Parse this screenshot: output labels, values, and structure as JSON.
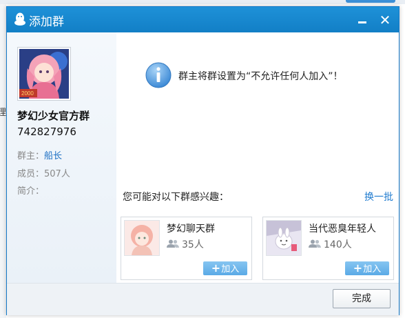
{
  "dialog": {
    "title": "添加群",
    "icon": "qq-penguin-icon"
  },
  "group": {
    "name": "梦幻少女官方群",
    "id": "742827976",
    "avatar_badge": "2000",
    "owner_label": "群主：",
    "owner_name": "船长",
    "members_label": "成员：",
    "members_value": "507人",
    "intro_label": "简介："
  },
  "notice": {
    "icon": "info-icon",
    "text": "群主将群设置为“不允许任何人加入”！"
  },
  "suggestions": {
    "label": "您可能对以下群感兴趣：",
    "refresh": "换一批",
    "items": [
      {
        "name": "梦幻聊天群",
        "count": "35人",
        "join": "加入"
      },
      {
        "name": "当代恶臭年轻人",
        "count": "140人",
        "join": "加入"
      }
    ]
  },
  "footer": {
    "done": "完成"
  },
  "colors": {
    "titlebar": "#1a88d0",
    "link": "#1f71c4",
    "join_button": "#6cb6ec"
  }
}
